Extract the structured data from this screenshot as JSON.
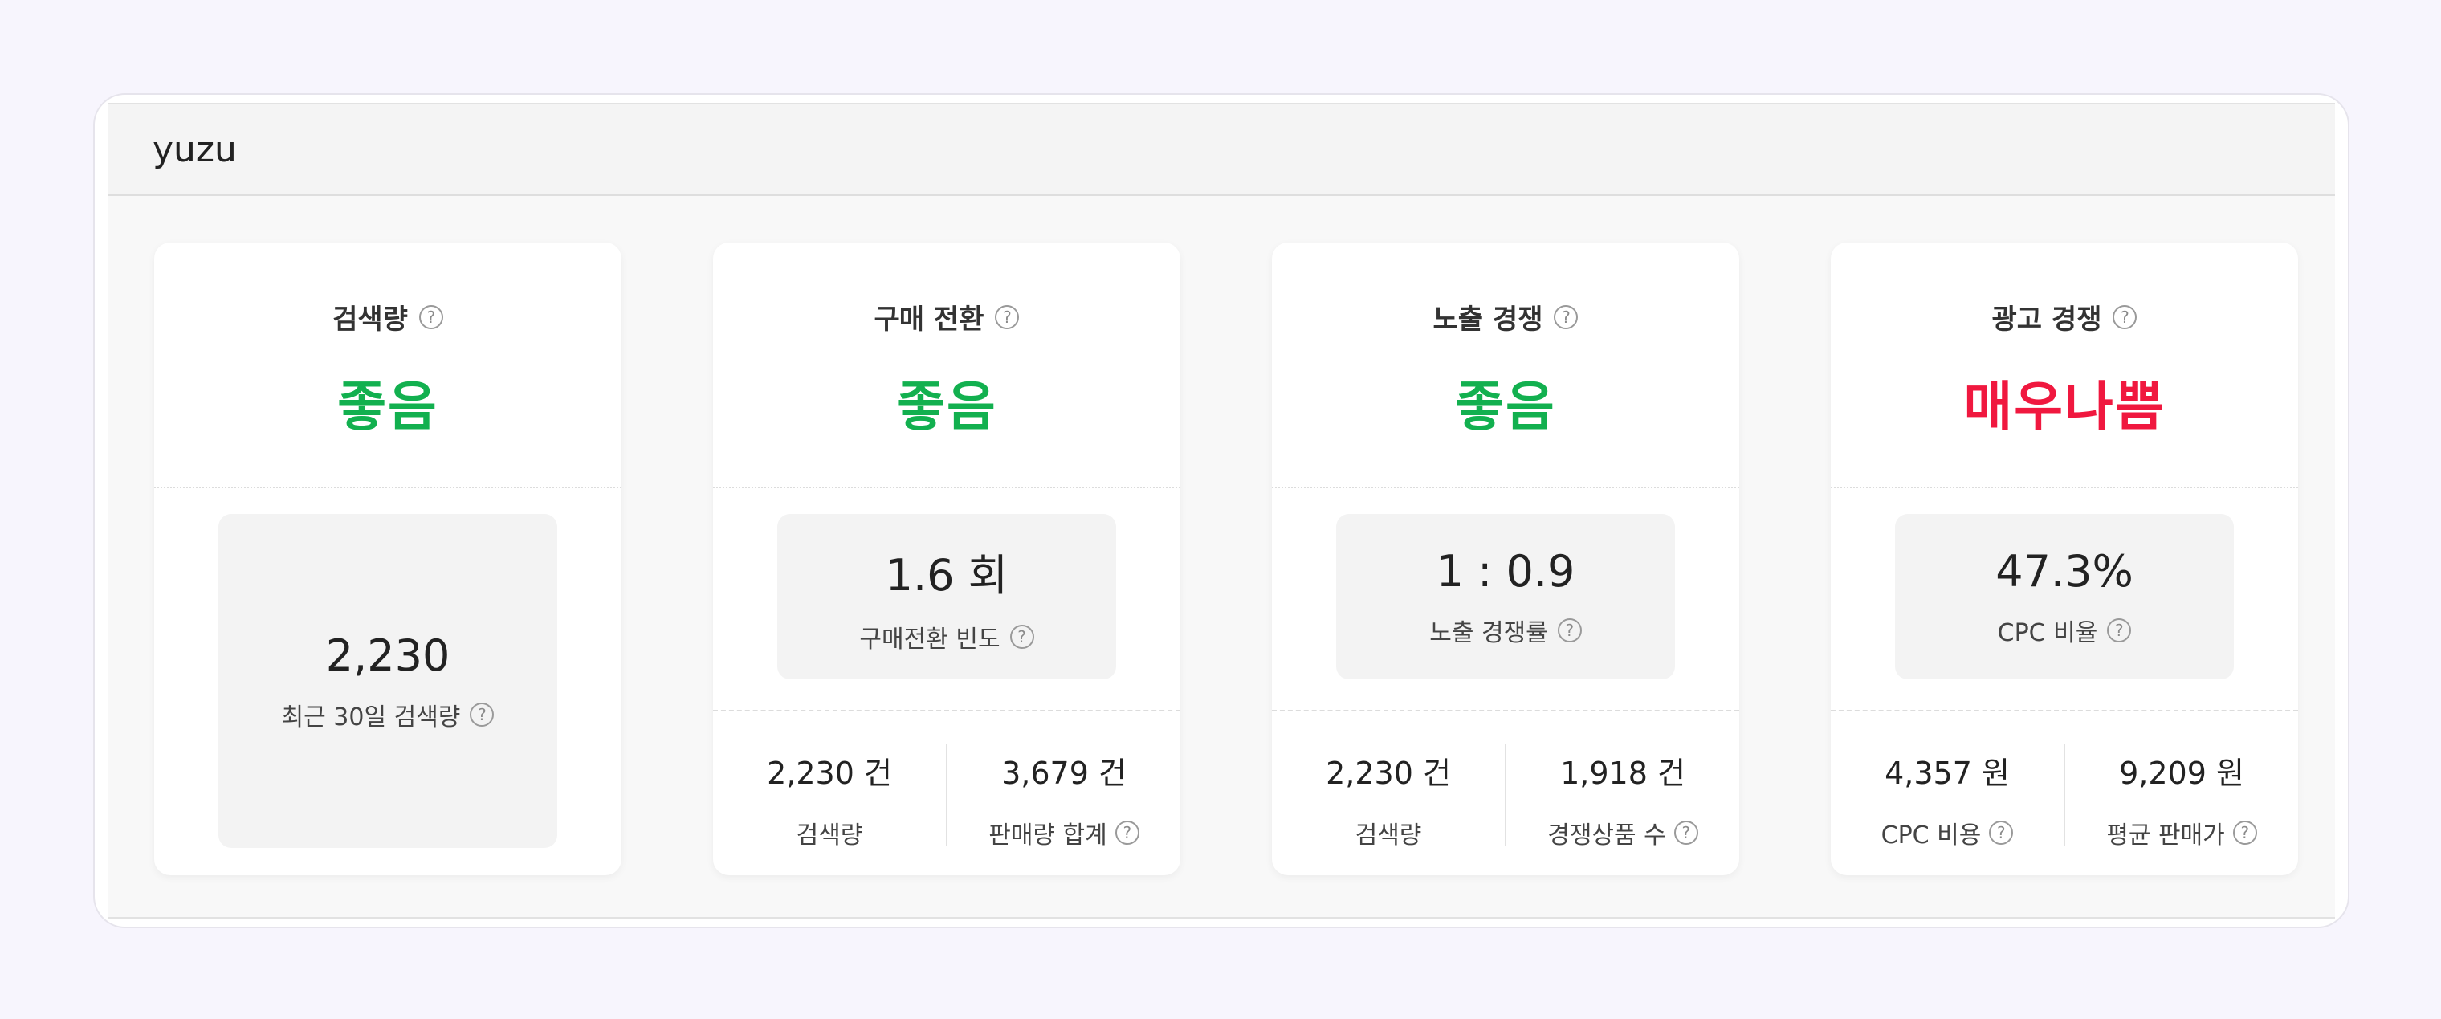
{
  "panel": {
    "title": "yuzu"
  },
  "colors": {
    "good": "#12b04f",
    "bad": "#f0183f",
    "background": "#f7f5fd"
  },
  "cards": [
    {
      "title": "검색량",
      "status": "좋음",
      "metric": {
        "value": "2,230",
        "label": "최근 30일 검색량"
      }
    },
    {
      "title": "구매 전환",
      "status": "좋음",
      "metric": {
        "value": "1.6 회",
        "label": "구매전환 빈도"
      },
      "subs": [
        {
          "value": "2,230 건",
          "label": "검색량"
        },
        {
          "value": "3,679 건",
          "label": "판매량 합계"
        }
      ]
    },
    {
      "title": "노출 경쟁",
      "status": "좋음",
      "metric": {
        "value": "1 : 0.9",
        "label": "노출 경쟁률"
      },
      "subs": [
        {
          "value": "2,230 건",
          "label": "검색량"
        },
        {
          "value": "1,918 건",
          "label": "경쟁상품 수"
        }
      ]
    },
    {
      "title": "광고 경쟁",
      "status": "매우나쁨",
      "metric": {
        "value": "47.3%",
        "label": "CPC 비율"
      },
      "subs": [
        {
          "value": "4,357 원",
          "label": "CPC 비용"
        },
        {
          "value": "9,209 원",
          "label": "평균 판매가"
        }
      ]
    }
  ],
  "icons": {
    "help": "question-circle-icon",
    "help_glyph": "?"
  }
}
